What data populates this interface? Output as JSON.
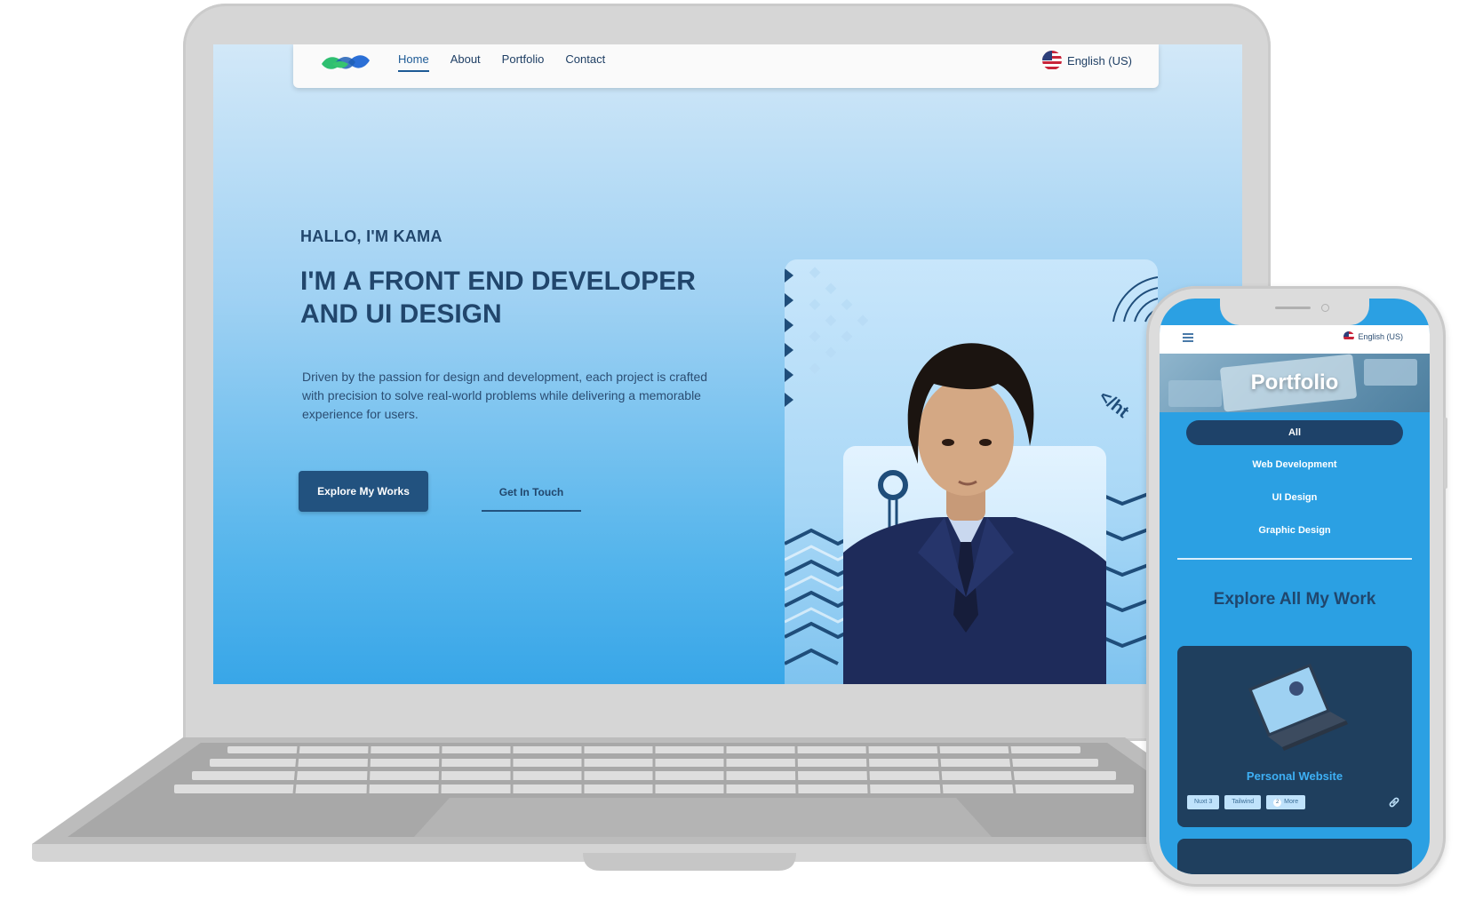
{
  "desktop": {
    "nav": {
      "links": [
        "Home",
        "About",
        "Portfolio",
        "Contact"
      ],
      "active": "Home",
      "language": "English (US)"
    },
    "hero": {
      "greeting": "HALLO, I'M KAMA",
      "title": "I'M A FRONT END DEVELOPER AND UI DESIGN",
      "description": "Driven by the passion for design and development, each project is crafted with precision to solve real-world problems while delivering a memorable experience for users.",
      "primary_button": "Explore My Works",
      "secondary_button": "Get In Touch",
      "code_tag": "</ht"
    }
  },
  "mobile": {
    "language": "English (US)",
    "banner_title": "Portfolio",
    "filters": [
      "All",
      "Web Development",
      "UI Design",
      "Graphic Design"
    ],
    "active_filter": "All",
    "section_title": "Explore All My Work",
    "card": {
      "title": "Personal Website",
      "tags": [
        "Nuxt 3",
        "Tailwind"
      ],
      "more_count": "2",
      "more_label": "More"
    }
  },
  "colors": {
    "brand_dark": "#22527f",
    "text_dark": "#21466c",
    "mobile_bg": "#2ba0e3",
    "card_bg": "#1f3f5e",
    "card_title": "#3eb0f5"
  },
  "icons": [
    "logo-icon",
    "flag-us-icon",
    "hamburger-menu-icon",
    "link-icon"
  ]
}
